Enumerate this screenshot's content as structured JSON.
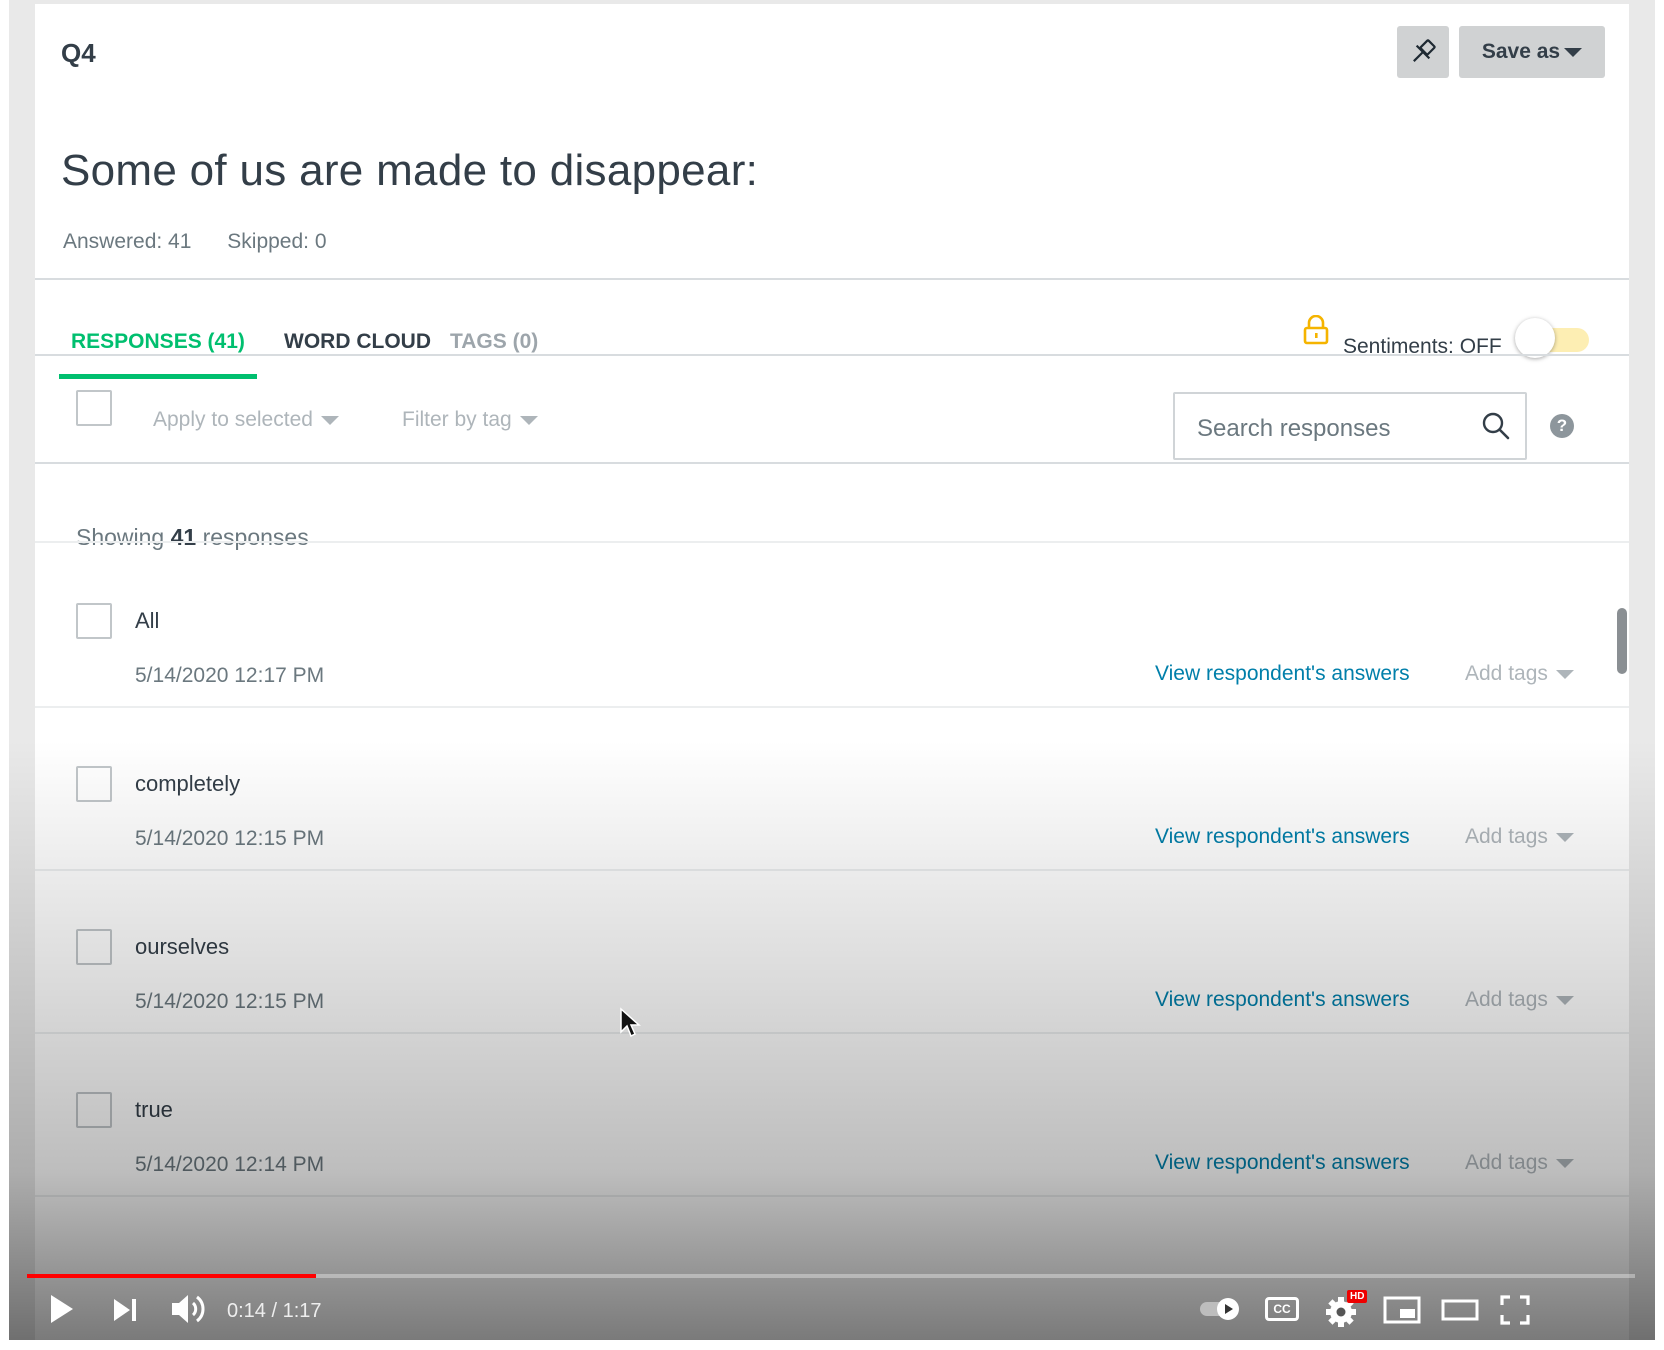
{
  "question": {
    "number": "Q4",
    "title": "Some of us are made to disappear:",
    "answered": "Answered: 41",
    "skipped": "Skipped: 0"
  },
  "header_buttons": {
    "pin_icon": "pin-icon",
    "save_as_label": "Save as"
  },
  "tabs": [
    {
      "label": "RESPONSES (41)",
      "active": true
    },
    {
      "label": "WORD CLOUD",
      "active": false
    },
    {
      "label": "TAGS (0)",
      "active": false
    }
  ],
  "sentiments": {
    "label": "Sentiments: OFF",
    "lock_color": "#f5b400",
    "on": false
  },
  "toolbar": {
    "apply_to_selected": "Apply to selected",
    "filter_by_tag": "Filter by tag",
    "search_placeholder": "Search responses",
    "help": "?"
  },
  "showing": {
    "prefix": "Showing",
    "count": "41",
    "suffix": "responses"
  },
  "responses": [
    {
      "answer": "All",
      "date": "5/14/2020 12:17 PM",
      "view": "View respondent's answers",
      "tags": "Add tags"
    },
    {
      "answer": "completely",
      "date": "5/14/2020 12:15 PM",
      "view": "View respondent's answers",
      "tags": "Add tags"
    },
    {
      "answer": "ourselves",
      "date": "5/14/2020 12:15 PM",
      "view": "View respondent's answers",
      "tags": "Add tags"
    },
    {
      "answer": "true",
      "date": "5/14/2020 12:14 PM",
      "view": "View respondent's answers",
      "tags": "Add tags"
    }
  ],
  "player": {
    "time": "0:14 / 1:17",
    "progress": 0.18,
    "hd_badge": "HD",
    "cc": "CC",
    "accent": "#ff0000"
  },
  "colors": {
    "accent_green": "#00bf6f",
    "link_blue": "#007faa"
  }
}
